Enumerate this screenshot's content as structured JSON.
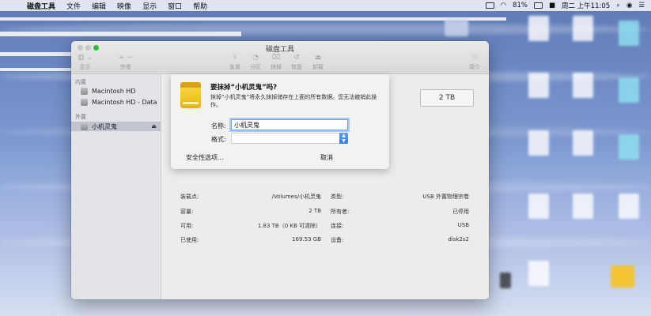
{
  "menubar": {
    "items": [
      "磁盘工具",
      "文件",
      "编辑",
      "映像",
      "显示",
      "窗口",
      "帮助"
    ],
    "battery": "81%",
    "clock": "周二 上午11:05"
  },
  "window": {
    "title": "磁盘工具",
    "toolbar": {
      "view": "显示",
      "volume": "宗卷",
      "first_aid": "急救",
      "partition": "分区",
      "erase": "抹掉",
      "restore": "恢复",
      "unmount": "卸载",
      "info": "简介"
    }
  },
  "sidebar": {
    "internal_header": "内置",
    "internal_items": [
      "Macintosh HD",
      "Macintosh HD - Data"
    ],
    "external_header": "外置",
    "external_items": [
      "小机灵鬼"
    ]
  },
  "capacity": "2 TB",
  "sheet": {
    "title": "要抹掉“小机灵鬼”吗?",
    "description": "抹掉“小机灵鬼”将永久抹掉储存在上面的所有数据。您无法撤销此操作。",
    "name_label": "名称:",
    "name_value": "小机灵鬼",
    "format_label": "格式:",
    "security_button": "安全性选项...",
    "cancel_button": "取消"
  },
  "info": {
    "rows": [
      {
        "label1": "装载点:",
        "value1": "/Volumes/小机灵鬼",
        "label2": "类型:",
        "value2": "USB 外置物理宗卷"
      },
      {
        "label1": "容量:",
        "value1": "2 TB",
        "label2": "所有者:",
        "value2": "已停用"
      },
      {
        "label1": "可用:",
        "value1": "1.83 TB（0 KB 可清除）",
        "label2": "连接:",
        "value2": "USB"
      },
      {
        "label1": "已使用:",
        "value1": "169.53 GB",
        "label2": "设备:",
        "value2": "disk2s2"
      }
    ]
  }
}
